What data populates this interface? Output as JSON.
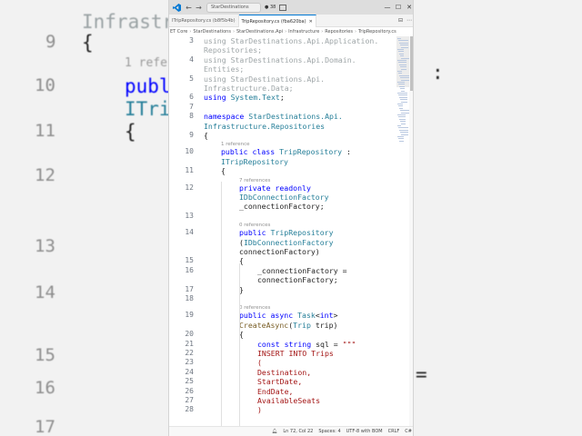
{
  "background": {
    "left": [
      {
        "num": "",
        "code": "Infrastru"
      },
      {
        "num": "9",
        "code": "{"
      },
      {
        "num": "",
        "code": "1 refer"
      },
      {
        "num": "10",
        "code": "publ"
      },
      {
        "num": "",
        "code": "ITri"
      },
      {
        "num": "11",
        "code": "{"
      },
      {
        "num": "12",
        "code": ""
      },
      {
        "num": "13",
        "code": ""
      },
      {
        "num": "14",
        "code": ""
      },
      {
        "num": "15",
        "code": ""
      },
      {
        "num": "16",
        "code": ""
      },
      {
        "num": "17",
        "code": ""
      }
    ],
    "right": [
      ":",
      "=",
      "\"\""
    ]
  },
  "titlebar": {
    "search_text": "StarDestinations",
    "badge_text": "38",
    "min_label": "—",
    "max_label": "☐",
    "close_label": "✕",
    "back_label": "←",
    "forward_label": "→"
  },
  "tabs": [
    {
      "label": "ITripRepository.cs (b8f5b4b)",
      "active": false
    },
    {
      "label": "TripRepository.cs (fba620ba)",
      "active": true
    }
  ],
  "breadcrumb": [
    "ET Core",
    "StarDestinations",
    "StarDestinations.Api",
    "Infrastructure",
    "Repositories",
    "TripRepository.cs"
  ],
  "editor": {
    "lines": [
      {
        "num": "3",
        "indent": 0,
        "parts": [
          [
            "kw fade",
            "using "
          ],
          [
            "fade",
            "StarDestinations.Api.Application."
          ]
        ]
      },
      {
        "num": "",
        "indent": 0,
        "parts": [
          [
            "fade",
            "Repositories;"
          ]
        ]
      },
      {
        "num": "4",
        "indent": 0,
        "parts": [
          [
            "kw fade",
            "using "
          ],
          [
            "fade",
            "StarDestinations.Api.Domain."
          ]
        ]
      },
      {
        "num": "",
        "indent": 0,
        "parts": [
          [
            "fade",
            "Entities;"
          ]
        ]
      },
      {
        "num": "5",
        "indent": 0,
        "parts": [
          [
            "kw fade",
            "using "
          ],
          [
            "fade",
            "StarDestinations.Api."
          ]
        ]
      },
      {
        "num": "",
        "indent": 0,
        "parts": [
          [
            "fade",
            "Infrastructure.Data;"
          ]
        ]
      },
      {
        "num": "6",
        "indent": 0,
        "parts": [
          [
            "kw",
            "using "
          ],
          [
            "ty",
            "System.Text"
          ],
          [
            "nm",
            ";"
          ]
        ]
      },
      {
        "num": "7",
        "indent": 0,
        "parts": []
      },
      {
        "num": "8",
        "indent": 0,
        "parts": [
          [
            "kw",
            "namespace "
          ],
          [
            "ty",
            "StarDestinations.Api."
          ]
        ]
      },
      {
        "num": "",
        "indent": 0,
        "parts": [
          [
            "ty",
            "Infrastructure.Repositories"
          ]
        ]
      },
      {
        "num": "9",
        "indent": 0,
        "parts": [
          [
            "nm",
            "{"
          ]
        ]
      },
      {
        "lens": "1 reference",
        "indent": 1
      },
      {
        "num": "10",
        "indent": 1,
        "parts": [
          [
            "kw",
            "public class "
          ],
          [
            "ty",
            "TripRepository "
          ],
          [
            "nm",
            ":"
          ]
        ]
      },
      {
        "num": "",
        "indent": 1,
        "parts": [
          [
            "ty",
            "ITripRepository"
          ]
        ]
      },
      {
        "num": "11",
        "indent": 1,
        "parts": [
          [
            "nm",
            "{"
          ]
        ]
      },
      {
        "lens": "7 references",
        "indent": 2
      },
      {
        "num": "12",
        "indent": 2,
        "parts": [
          [
            "kw",
            "private readonly"
          ]
        ]
      },
      {
        "num": "",
        "indent": 2,
        "parts": [
          [
            "ty",
            "IDbConnectionFactory"
          ]
        ]
      },
      {
        "num": "",
        "indent": 2,
        "parts": [
          [
            "nm",
            "_connectionFactory;"
          ]
        ]
      },
      {
        "num": "13",
        "indent": 0,
        "parts": []
      },
      {
        "lens": "0 references",
        "indent": 2
      },
      {
        "num": "14",
        "indent": 2,
        "parts": [
          [
            "kw",
            "public "
          ],
          [
            "ty",
            "TripRepository"
          ]
        ]
      },
      {
        "num": "",
        "indent": 2,
        "parts": [
          [
            "nm",
            "("
          ],
          [
            "ty",
            "IDbConnectionFactory"
          ]
        ]
      },
      {
        "num": "",
        "indent": 2,
        "parts": [
          [
            "nm",
            "connectionFactory)"
          ]
        ]
      },
      {
        "num": "15",
        "indent": 2,
        "parts": [
          [
            "nm",
            "{"
          ]
        ]
      },
      {
        "num": "16",
        "indent": 3,
        "parts": [
          [
            "nm",
            "_connectionFactory ="
          ]
        ]
      },
      {
        "num": "",
        "indent": 3,
        "parts": [
          [
            "nm",
            "connectionFactory;"
          ]
        ]
      },
      {
        "num": "17",
        "indent": 2,
        "parts": [
          [
            "nm",
            "}"
          ]
        ]
      },
      {
        "num": "18",
        "indent": 0,
        "parts": []
      },
      {
        "lens": "0 references",
        "indent": 2
      },
      {
        "num": "19",
        "indent": 2,
        "parts": [
          [
            "kw",
            "public async "
          ],
          [
            "ty",
            "Task"
          ],
          [
            "nm",
            "<"
          ],
          [
            "kw",
            "int"
          ],
          [
            "nm",
            ">"
          ]
        ]
      },
      {
        "num": "",
        "indent": 2,
        "parts": [
          [
            "fn",
            "CreateAsync"
          ],
          [
            "nm",
            "("
          ],
          [
            "ty",
            "Trip "
          ],
          [
            "nm",
            "trip)"
          ]
        ]
      },
      {
        "num": "20",
        "indent": 2,
        "parts": [
          [
            "nm",
            "{"
          ]
        ]
      },
      {
        "num": "21",
        "indent": 3,
        "parts": [
          [
            "kw",
            "const string "
          ],
          [
            "nm",
            "sql = "
          ],
          [
            "str",
            "\"\"\""
          ]
        ]
      },
      {
        "num": "22",
        "indent": 3,
        "parts": [
          [
            "str",
            "INSERT INTO Trips"
          ]
        ]
      },
      {
        "num": "23",
        "indent": 3,
        "parts": [
          [
            "str",
            "("
          ]
        ]
      },
      {
        "num": "24",
        "indent": 3,
        "parts": [
          [
            "str",
            "Destination,"
          ]
        ]
      },
      {
        "num": "25",
        "indent": 3,
        "parts": [
          [
            "str",
            "StartDate,"
          ]
        ]
      },
      {
        "num": "26",
        "indent": 3,
        "parts": [
          [
            "str",
            "EndDate,"
          ]
        ]
      },
      {
        "num": "27",
        "indent": 3,
        "parts": [
          [
            "str",
            "AvailableSeats"
          ]
        ]
      },
      {
        "num": "28",
        "indent": 3,
        "parts": [
          [
            "str",
            ")"
          ]
        ]
      }
    ]
  },
  "statusbar": {
    "position": "Ln 72, Col 22",
    "spaces": "Spaces: 4",
    "encoding": "UTF-8 with BOM",
    "eol": "CRLF",
    "language": "C#"
  },
  "colors": {
    "accent": "#0078d4",
    "keyword": "#0000ff",
    "type": "#267f99",
    "string": "#a31515"
  }
}
